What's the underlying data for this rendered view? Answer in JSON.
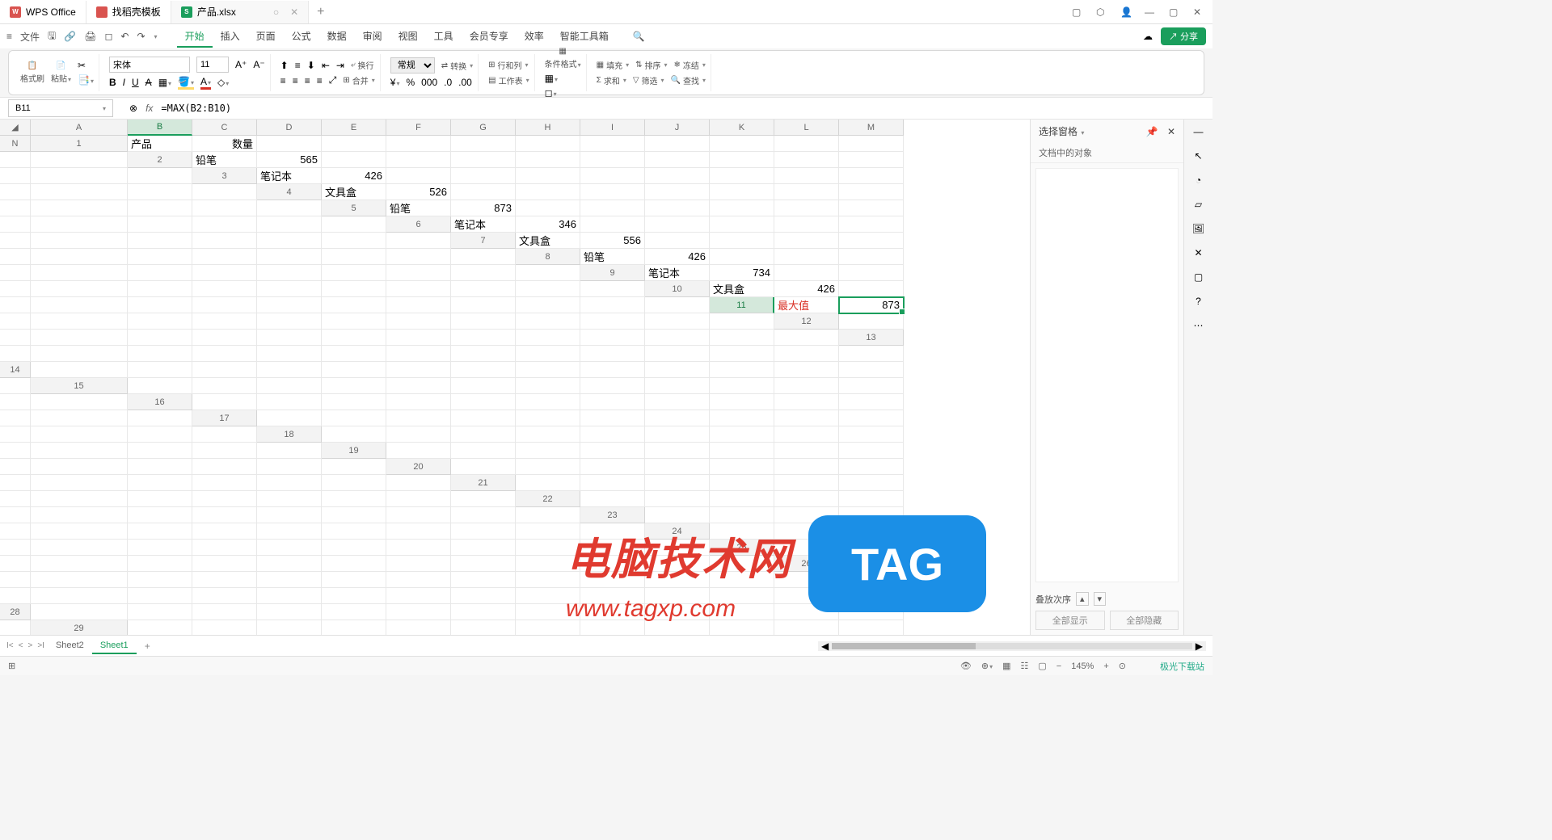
{
  "titlebar": {
    "tabs": [
      {
        "label": "WPS Office",
        "icon": "wps"
      },
      {
        "label": "找稻壳模板",
        "icon": "doc"
      },
      {
        "label": "产品.xlsx",
        "icon": "xls",
        "active": true
      }
    ]
  },
  "menubar": {
    "file": "文件",
    "items": [
      "开始",
      "插入",
      "页面",
      "公式",
      "数据",
      "审阅",
      "视图",
      "工具",
      "会员专享",
      "效率",
      "智能工具箱"
    ],
    "active": "开始",
    "share": "分享"
  },
  "ribbon": {
    "format_painter": "格式刷",
    "paste": "粘贴",
    "font_name": "宋体",
    "font_size": "11",
    "wrap": "换行",
    "merge": "合并",
    "number_format": "常规",
    "convert": "转换",
    "rowcol": "行和列",
    "worksheet": "工作表",
    "cond_format": "条件格式",
    "fill": "填充",
    "sort": "排序",
    "freeze": "冻结",
    "sum": "求和",
    "filter": "筛选",
    "find": "查找"
  },
  "formula_bar": {
    "cell_ref": "B11",
    "formula": "=MAX(B2:B10)"
  },
  "columns": [
    "A",
    "B",
    "C",
    "D",
    "E",
    "F",
    "G",
    "H",
    "I",
    "J",
    "K",
    "L",
    "M",
    "N"
  ],
  "rows": 30,
  "selected": {
    "col": "B",
    "row": 11
  },
  "data": {
    "A1": "产品",
    "B1": "数量",
    "A2": "铅笔",
    "B2": "565",
    "A3": "笔记本",
    "B3": "426",
    "A4": "文具盒",
    "B4": "526",
    "A5": "铅笔",
    "B5": "873",
    "A6": "笔记本",
    "B6": "346",
    "A7": "文具盒",
    "B7": "556",
    "A8": "铅笔",
    "B8": "426",
    "A9": "笔记本",
    "B9": "734",
    "A10": "文具盒",
    "B10": "426",
    "A11": "最大值",
    "B11": "873"
  },
  "red_cells": [
    "A11"
  ],
  "sheets": {
    "list": [
      "Sheet2",
      "Sheet1"
    ],
    "active": "Sheet1"
  },
  "side_panel": {
    "title": "选择窗格",
    "subtitle": "文档中的对象",
    "stack_order": "叠放次序",
    "show_all": "全部显示",
    "hide_all": "全部隐藏"
  },
  "status": {
    "zoom": "145%"
  },
  "watermark": {
    "text": "电脑技术网",
    "url": "www.tagxp.com",
    "tag": "TAG",
    "corner": "极光下载站"
  }
}
